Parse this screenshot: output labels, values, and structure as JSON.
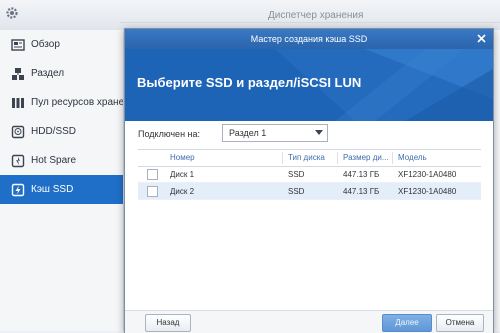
{
  "topbar": {
    "title": "Диспетчер хранения"
  },
  "sidebar": {
    "items": [
      {
        "label": "Обзор",
        "icon": "overview-icon"
      },
      {
        "label": "Раздел",
        "icon": "volume-icon"
      },
      {
        "label": "Пул ресурсов хранени",
        "icon": "storage-pool-icon"
      },
      {
        "label": "HDD/SSD",
        "icon": "hdd-icon"
      },
      {
        "label": "Hot Spare",
        "icon": "hot-spare-icon"
      },
      {
        "label": "Кэш SSD",
        "icon": "ssd-cache-icon",
        "active": true
      }
    ]
  },
  "dialog": {
    "title": "Мастер создания кэша SSD",
    "heading": "Выберите SSD и раздел/iSCSI LUN",
    "connected_label": "Подключен на:",
    "connected_value": "Раздел 1",
    "table": {
      "columns": [
        "Номер",
        "Тип диска",
        "Размер ди...",
        "Модель"
      ],
      "rows": [
        {
          "name": "Диск 1",
          "type": "SSD",
          "size": "447.13 ГБ",
          "model": "XF1230-1A0480",
          "selected": false
        },
        {
          "name": "Диск 2",
          "type": "SSD",
          "size": "447.13 ГБ",
          "model": "XF1230-1A0480",
          "selected": true
        }
      ]
    },
    "buttons": {
      "back": "Назад",
      "next": "Далее",
      "cancel": "Отмена"
    }
  },
  "colors": {
    "accent": "#1f6fc8",
    "banner": "#1d63b6",
    "selected_row": "#e3eefa"
  }
}
